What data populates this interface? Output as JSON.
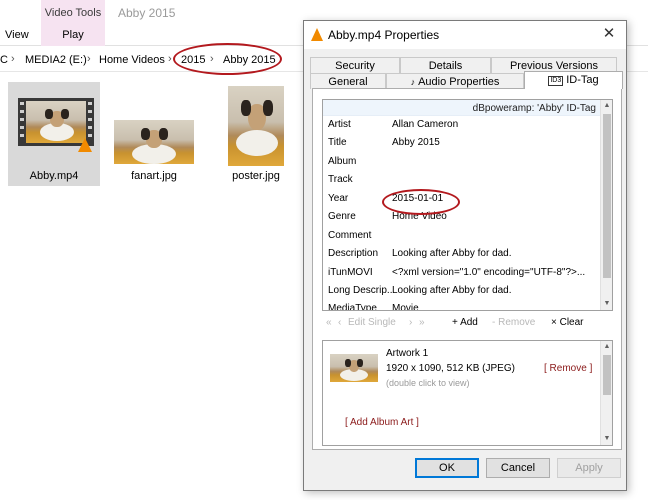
{
  "ribbon": {
    "view_tab": "View",
    "context_tab_title": "Video Tools",
    "context_tab_play": "Play",
    "window_title": "Abby 2015"
  },
  "address": {
    "crumbs": [
      "C",
      "MEDIA2 (E:)",
      "Home Videos",
      "2015",
      "Abby 2015"
    ]
  },
  "files": [
    {
      "name": "Abby.mp4",
      "type": "video",
      "selected": true
    },
    {
      "name": "fanart.jpg",
      "type": "image"
    },
    {
      "name": "poster.jpg",
      "type": "image"
    }
  ],
  "dialog": {
    "title": "Abby.mp4 Properties",
    "tabs_row1": [
      "Security",
      "Details",
      "Previous Versions"
    ],
    "tabs_row2": [
      "General",
      "Audio Properties",
      "ID-Tag"
    ],
    "active_tab": "ID-Tag",
    "id3_badge": "ID3",
    "tag_header": "dBpoweramp: 'Abby' ID-Tag",
    "tags": [
      {
        "name": "Artist",
        "value": "Allan Cameron"
      },
      {
        "name": "Title",
        "value": "Abby 2015"
      },
      {
        "name": "Album",
        "value": ""
      },
      {
        "name": "Track",
        "value": ""
      },
      {
        "name": "Year",
        "value": "2015-01-01"
      },
      {
        "name": "Genre",
        "value": "Home Video"
      },
      {
        "name": "Comment",
        "value": ""
      },
      {
        "name": "Description",
        "value": "Looking after Abby for dad."
      },
      {
        "name": "iTunMOVI",
        "value": "<?xml version=\"1.0\" encoding=\"UTF-8\"?>..."
      },
      {
        "name": "Long Descrip...",
        "value": "Looking after Abby for dad."
      },
      {
        "name": "MediaType",
        "value": "Movie"
      }
    ],
    "toolbar": {
      "prev_first": "«",
      "prev": "‹",
      "edit_single": "Edit Single",
      "next": "›",
      "next_last": "»",
      "add": "+ Add",
      "remove": "- Remove",
      "clear": "× Clear"
    },
    "artwork": {
      "title": "Artwork 1",
      "info": "1920 x 1090, 512 KB  (JPEG)",
      "hint": "(double click to view)",
      "remove": "[ Remove ]",
      "add": "[ Add Album Art ]"
    },
    "buttons": {
      "ok": "OK",
      "cancel": "Cancel",
      "apply": "Apply"
    }
  },
  "colors": {
    "context_tab_bg": "#f6e3f1",
    "selection_bg": "#d9d9d9",
    "annotation_red": "#b3191e",
    "link_red": "#8b1a1a",
    "vlc_orange": "#f18a00"
  }
}
